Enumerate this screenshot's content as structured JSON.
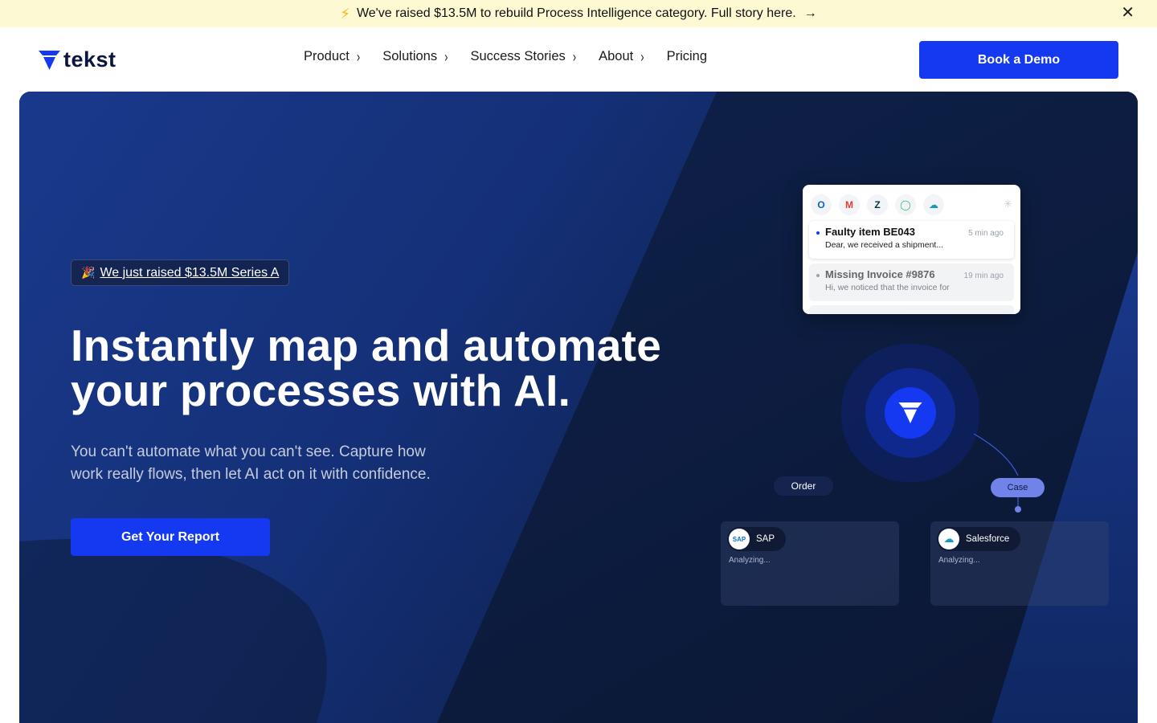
{
  "announcement": {
    "text": "We've raised $13.5M to rebuild Process Intelligence category. Full story here.",
    "icon": "lightning-bolt-icon",
    "arrow_icon": "arrow-right-icon",
    "close_icon": "close-icon"
  },
  "nav": {
    "logo_text": "tekst",
    "items": [
      {
        "label": "Product",
        "has_submenu": true
      },
      {
        "label": "Solutions",
        "has_submenu": true
      },
      {
        "label": "Success Stories",
        "has_submenu": true
      },
      {
        "label": "About",
        "has_submenu": true
      },
      {
        "label": "Pricing",
        "has_submenu": false
      }
    ],
    "cta_label": "Book a Demo"
  },
  "hero": {
    "badge_text": "We just raised $13.5M Series A",
    "badge_icon": "party-popper-icon",
    "headline_line1": "Instantly map and automate",
    "headline_line2": "your processes with AI.",
    "subheadline_line1": "You can't automate what you can't see. Capture how",
    "subheadline_line2": "work really flows, then let AI act on it with confidence.",
    "cta_label": "Get Your Report"
  },
  "inbox": {
    "apps": [
      "outlook-icon",
      "gmail-icon",
      "zendesk-icon",
      "freshdesk-icon",
      "salesforce-icon"
    ],
    "messages": [
      {
        "title": "Faulty item BE043",
        "time": "5 min ago",
        "preview": "Dear, we received a shipment..."
      },
      {
        "title": "Missing Invoice #9876",
        "time": "19 min ago",
        "preview": "Hi, we noticed that the invoice for"
      }
    ]
  },
  "flow": {
    "tag_left": "Order",
    "tag_right": "Case",
    "systems": [
      {
        "name": "SAP",
        "status": "Analyzing..."
      },
      {
        "name": "Salesforce",
        "status": "Analyzing..."
      }
    ]
  },
  "colors": {
    "brand_blue": "#1539f0",
    "navy": "#0b1540",
    "hero_bg": "#0d1b3a",
    "announce_bg": "#fdf9d2"
  }
}
